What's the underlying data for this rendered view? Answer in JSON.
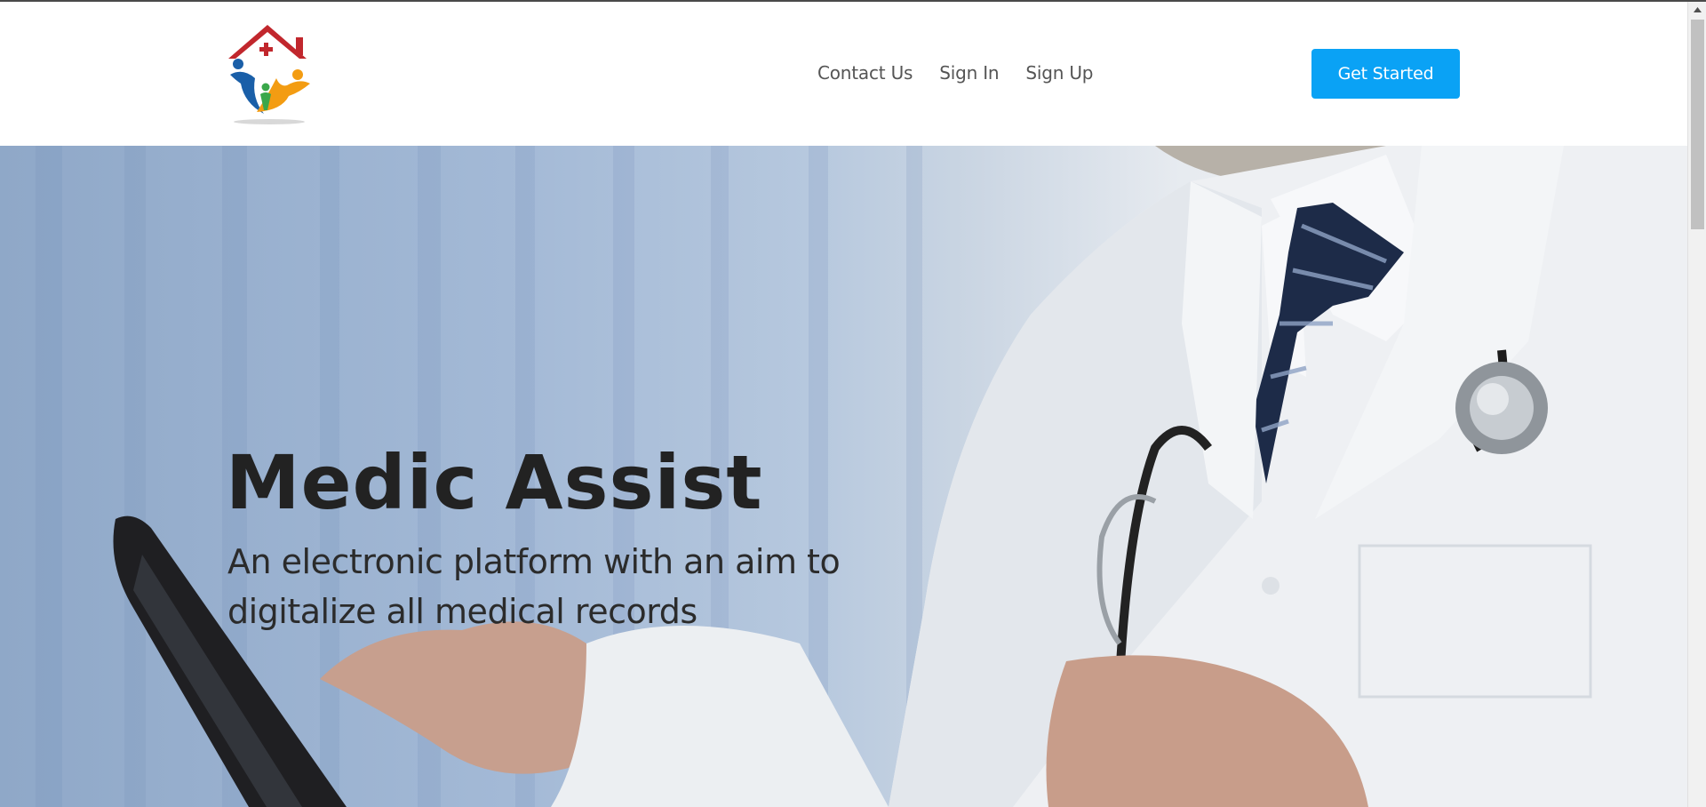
{
  "header": {
    "logo_name": "medic-assist-logo",
    "nav": [
      {
        "label": "Contact Us"
      },
      {
        "label": "Sign In"
      },
      {
        "label": "Sign Up"
      }
    ],
    "cta_label": "Get Started"
  },
  "hero": {
    "title": "Medic Assist",
    "subtitle": "An electronic platform with an aim to digitalize all medical records"
  },
  "colors": {
    "accent": "#0aa2f5",
    "nav_text": "#555555",
    "hero_text": "#222222"
  }
}
